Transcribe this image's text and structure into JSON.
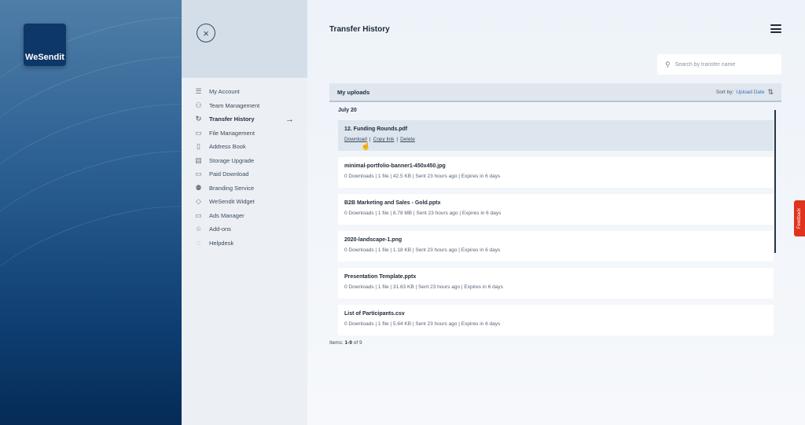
{
  "brand": {
    "logo_text": "WeSendit"
  },
  "nav": {
    "close_glyph": "×",
    "items": [
      {
        "label": "My Account",
        "icon": "account-list-icon",
        "glyph": "☰"
      },
      {
        "label": "Team Management",
        "icon": "team-icon",
        "glyph": "⚇"
      },
      {
        "label": "Transfer History",
        "icon": "history-icon",
        "glyph": "↻",
        "active": true
      },
      {
        "label": "File Management",
        "icon": "folder-icon",
        "glyph": "▭"
      },
      {
        "label": "Address Book",
        "icon": "address-book-icon",
        "glyph": "▯"
      },
      {
        "label": "Storage Upgrade",
        "icon": "storage-icon",
        "glyph": "▤"
      },
      {
        "label": "Paid Download",
        "icon": "paid-download-icon",
        "glyph": "▭"
      },
      {
        "label": "Branding Service",
        "icon": "branding-icon",
        "glyph": "⚉"
      },
      {
        "label": "WeSendit Widget",
        "icon": "widget-tag-icon",
        "glyph": "◇"
      },
      {
        "label": "Ads Manager",
        "icon": "ads-icon",
        "glyph": "▭"
      },
      {
        "label": "Add-ons",
        "icon": "star-icon",
        "glyph": "☆"
      },
      {
        "label": "Helpdesk",
        "icon": "chat-icon",
        "glyph": "◌"
      }
    ],
    "active_arrow": "→"
  },
  "header": {
    "title": "Transfer History"
  },
  "search": {
    "placeholder": "Search by transfer name"
  },
  "uploads": {
    "title": "My uploads",
    "sort_label": "Sort by:",
    "sort_value": "Upload Date",
    "group_label": "July 20",
    "rows": [
      {
        "name": "12. Funding Rounds.pdf",
        "hover": true,
        "actions": [
          "Download",
          "Copy link",
          "Delete"
        ]
      },
      {
        "name": "minimal-portfolio-banner1-450x450.jpg",
        "meta": "0 Downloads | 1 file | 42.5 KB | Sent 23 hours ago | Expires in 6 days"
      },
      {
        "name": "B2B Marketing and Sales - Gold.pptx",
        "meta": "0 Downloads | 1 file | 8.78 MB | Sent 23 hours ago | Expires in 6 days"
      },
      {
        "name": "2020-landscape-1.png",
        "meta": "0 Downloads | 1 file | 1.18 KB | Sent 23 hours ago | Expires in 6 days"
      },
      {
        "name": "Presentation Template.pptx",
        "meta": "0 Downloads | 1 file | 31.63 KB | Sent 23 hours ago | Expires in 6 days"
      },
      {
        "name": "List of Participants.csv",
        "meta": "0 Downloads | 1 file | 5.64 KB | Sent 23 hours ago | Expires in 6 days"
      }
    ],
    "items_label": "Items:",
    "items_range": "1-9",
    "items_total": "of 9"
  },
  "feedback": {
    "label": "Feedback"
  },
  "colors": {
    "accent": "#3a74b0",
    "feedback": "#e0321c",
    "brand_dark": "#0d3766"
  }
}
